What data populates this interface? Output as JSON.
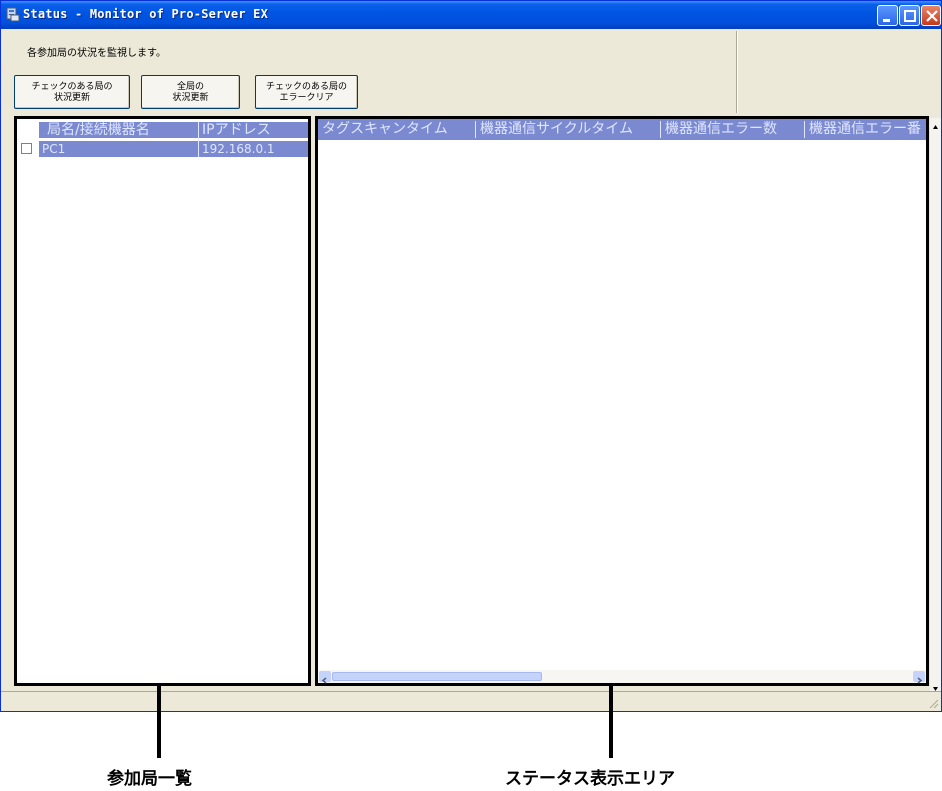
{
  "window": {
    "title": "Status - Monitor of Pro-Server EX",
    "description": "各参加局の状況を監視します。"
  },
  "toolbar": {
    "update_checked_label": "チェックのある局の\n状況更新",
    "update_all_label": "全局の\n状況更新",
    "clear_errors_label": "チェックのある局の\nエラークリア"
  },
  "station_list": {
    "columns": [
      "局名/接続機器名",
      "IPアドレス"
    ],
    "rows": [
      {
        "name": "PC1",
        "ip": "192.168.0.1",
        "checked": false
      }
    ]
  },
  "status_area": {
    "columns": [
      "タグスキャンタイム",
      "機器通信サイクルタイム",
      "機器通信エラー数",
      "機器通信エラー番"
    ]
  },
  "callouts": {
    "station_list_label": "参加局一覧",
    "status_area_label": "ステータス表示エリア"
  },
  "colors": {
    "titlebar": "#0054e3",
    "header_bg": "#7b8ad0",
    "window_bg": "#ece9d8"
  }
}
